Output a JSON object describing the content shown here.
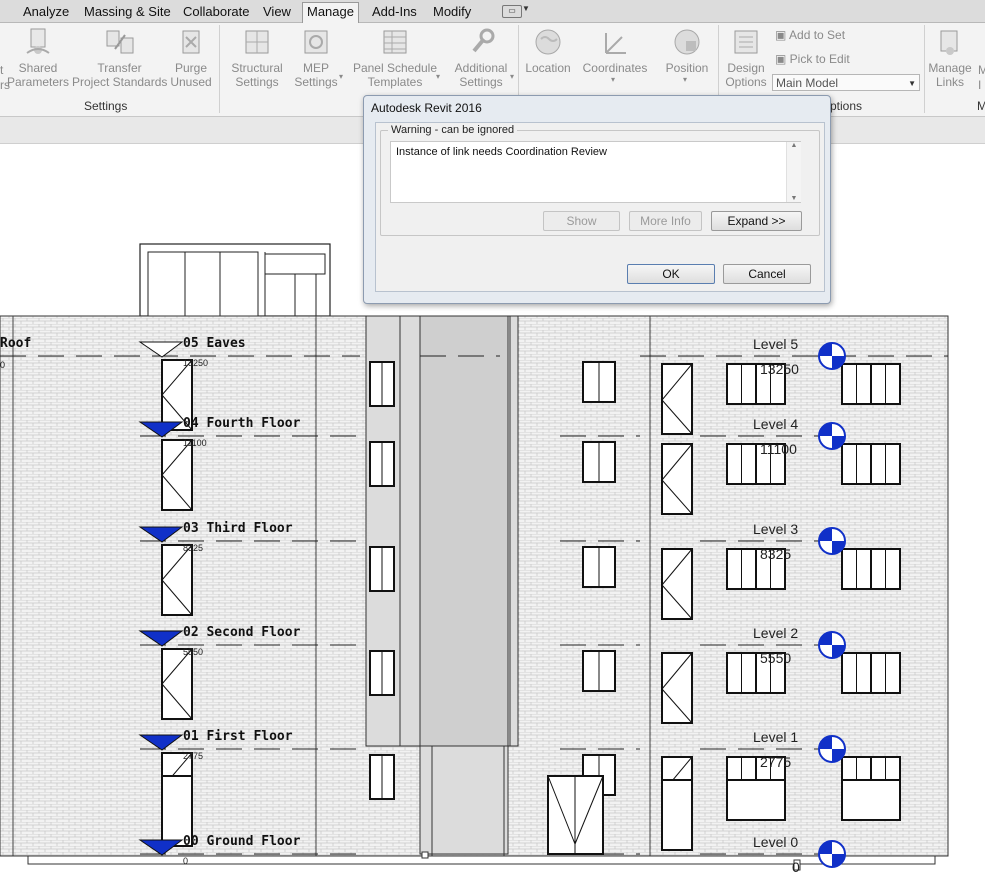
{
  "menubar": {
    "tabs": [
      "Analyze",
      "Massing & Site",
      "Collaborate",
      "View",
      "Manage",
      "Add-Ins",
      "Modify"
    ],
    "active": "Manage"
  },
  "ribbon": {
    "buttons": [
      {
        "label1": "Shared",
        "label2": "Parameters",
        "icon": "shared-parameters-icon"
      },
      {
        "label1": "Transfer",
        "label2": "Project Standards",
        "icon": "transfer-standards-icon"
      },
      {
        "label1": "Purge",
        "label2": "Unused",
        "icon": "purge-icon"
      },
      {
        "label1": "Structural",
        "label2": "Settings",
        "icon": "structural-settings-icon"
      },
      {
        "label1": "MEP",
        "label2": "Settings",
        "icon": "mep-settings-icon"
      },
      {
        "label1": "Panel Schedule",
        "label2": "Templates",
        "icon": "panel-schedule-icon"
      },
      {
        "label1": "Additional",
        "label2": "Settings",
        "icon": "wrench-icon"
      },
      {
        "label1": "Location",
        "label2": "",
        "icon": "globe-icon"
      },
      {
        "label1": "Coordinates",
        "label2": "",
        "icon": "coordinates-icon"
      },
      {
        "label1": "Position",
        "label2": "",
        "icon": "position-icon"
      },
      {
        "label1": "Design",
        "label2": "Options",
        "icon": "design-options-icon"
      },
      {
        "label1": "Manage",
        "label2": "Links",
        "icon": "manage-links-icon"
      }
    ],
    "small_buttons": {
      "add_to_set": "Add to Set",
      "pick_to_edit": "Pick to Edit"
    },
    "combo_value": "Main Model",
    "panel_labels": {
      "settings": "Settings",
      "design_options": "ptions",
      "manage": "M"
    },
    "left_fragments": {
      "line1": "t",
      "line2": "rs"
    },
    "right_fragments": {
      "line1": "M",
      "line2": "I"
    }
  },
  "dialog": {
    "title": "Autodesk Revit 2016",
    "group_label": "Warning - can be ignored",
    "message": "Instance of link needs Coordination Review",
    "buttons": {
      "show": "Show",
      "more_info": "More Info",
      "expand": "Expand >>",
      "ok": "OK",
      "cancel": "Cancel"
    }
  },
  "right_levels": [
    {
      "name": "Level 5",
      "value": "13250"
    },
    {
      "name": "Level 4",
      "value": "11100"
    },
    {
      "name": "Level 3",
      "value": "8325"
    },
    {
      "name": "Level 2",
      "value": "5550"
    },
    {
      "name": "Level 1",
      "value": "2775"
    },
    {
      "name": "Level 0",
      "value": "0"
    }
  ],
  "left_levels": [
    {
      "name": "05 Eaves",
      "value": "13250"
    },
    {
      "name": "04 Fourth Floor",
      "value": "11100"
    },
    {
      "name": "03 Third Floor",
      "value": "8325"
    },
    {
      "name": "02 Second Floor",
      "value": "5550"
    },
    {
      "name": "01 First Floor",
      "value": "2775"
    },
    {
      "name": "00 Ground Floor",
      "value": "0"
    }
  ],
  "edge_labels": {
    "roof": "Roof",
    "zero": "0"
  },
  "colors": {
    "level_marker": "#1030c8",
    "brick": "#e9e9e9",
    "menubar": "#dcdcdc",
    "ribbon": "#f3f3f3"
  }
}
